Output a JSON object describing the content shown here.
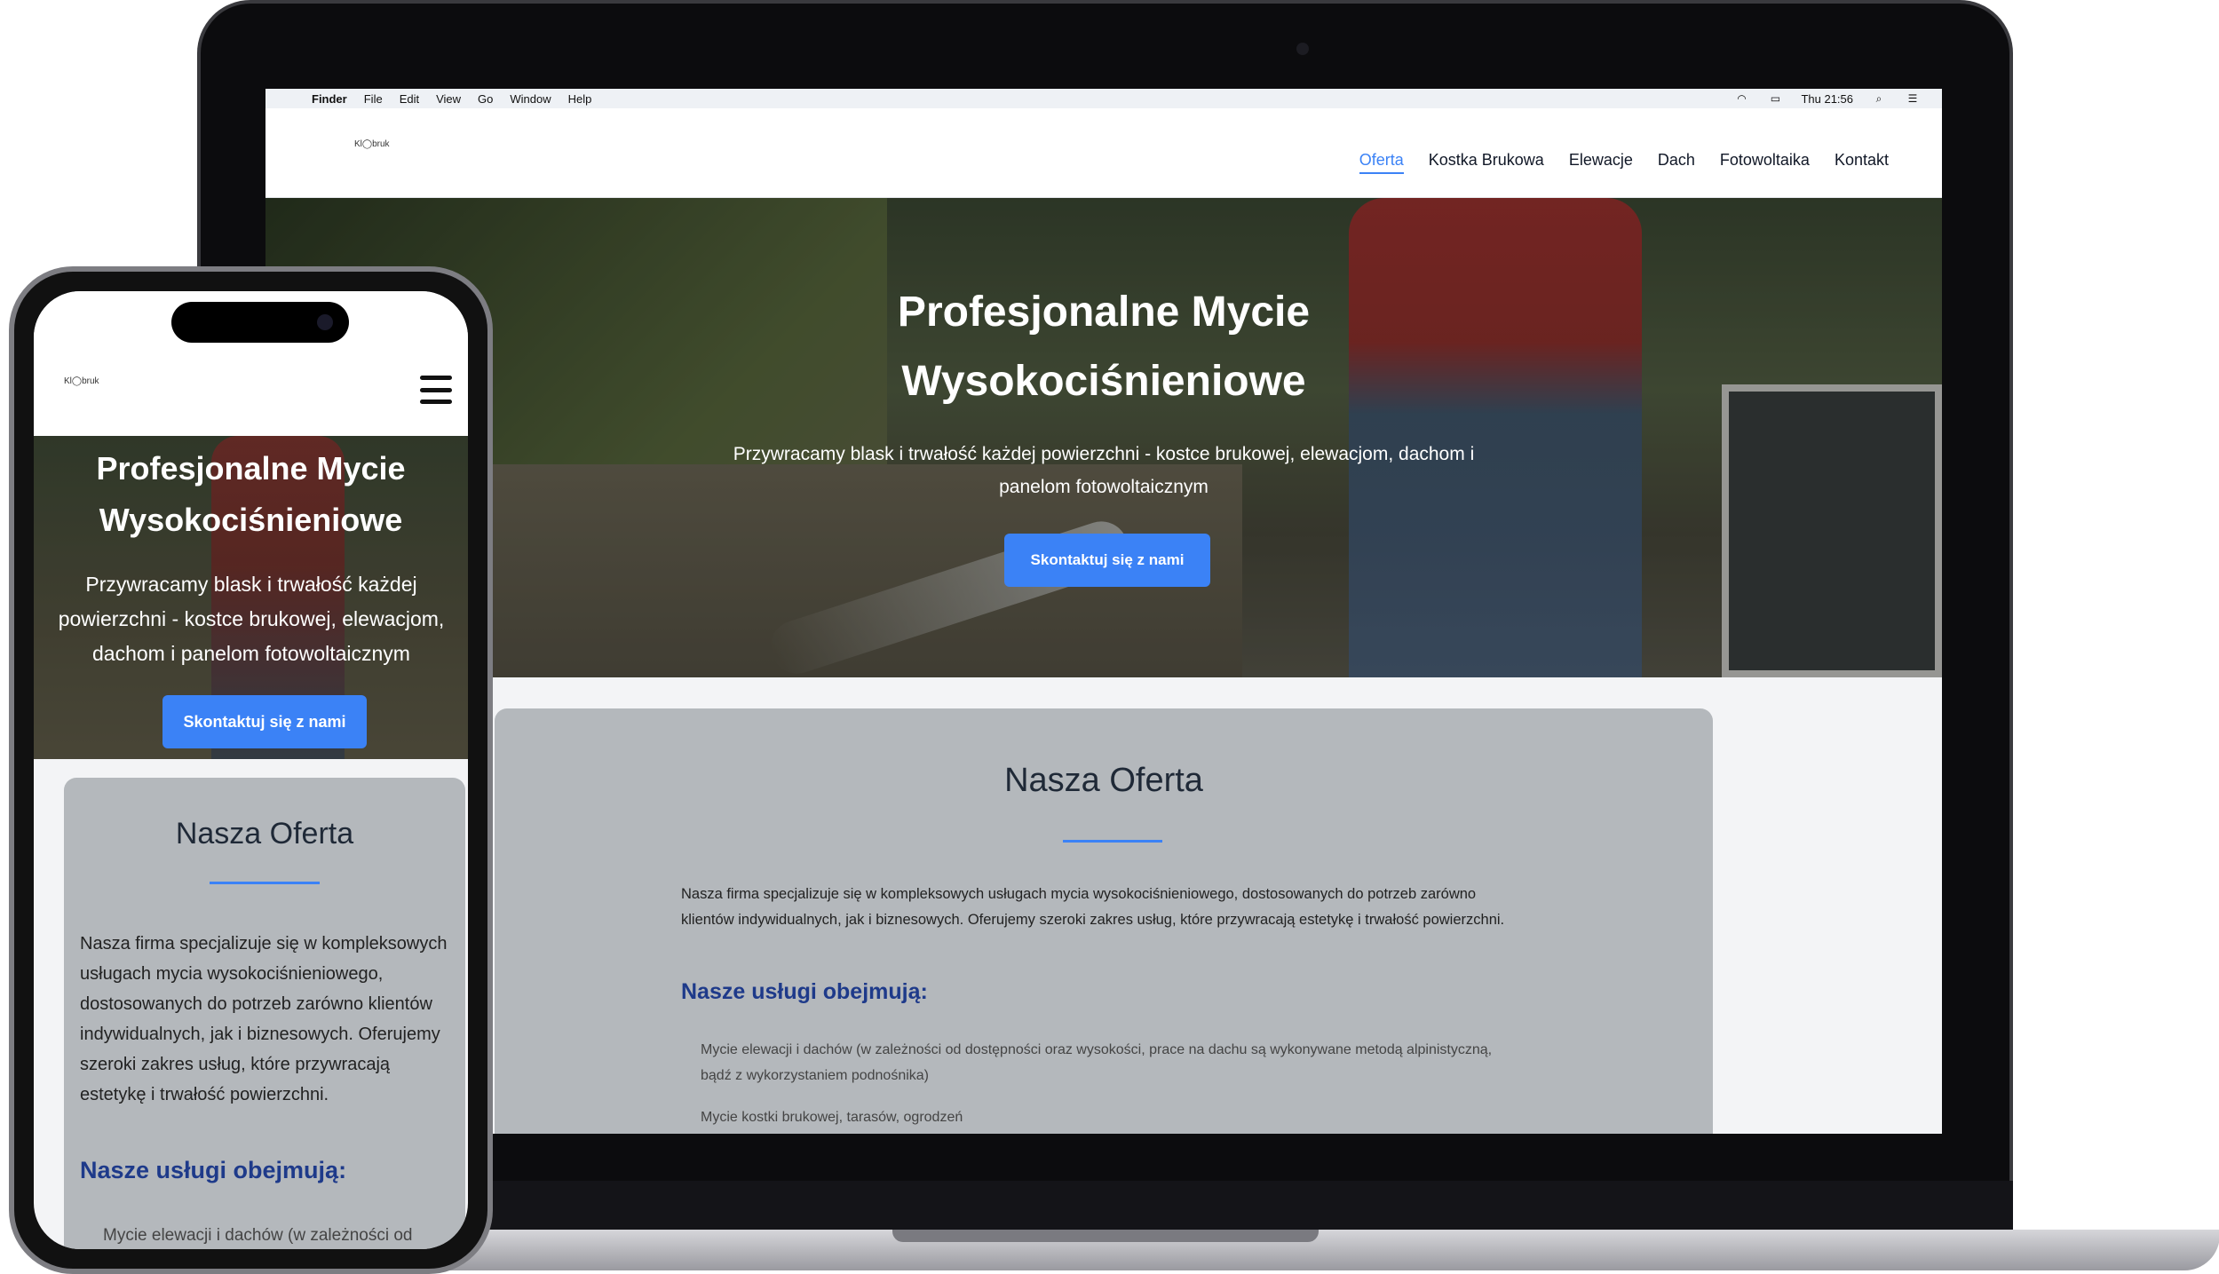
{
  "menubar": {
    "items": [
      "Finder",
      "File",
      "Edit",
      "View",
      "Go",
      "Window",
      "Help"
    ],
    "clock": "Thu 21:56"
  },
  "site": {
    "logo": "Kl◯bruk",
    "nav": [
      "Oferta",
      "Kostka Brukowa",
      "Elewacje",
      "Dach",
      "Fotowoltaika",
      "Kontakt"
    ],
    "hero": {
      "title_line1": "Profesjonalne Mycie",
      "title_line2": "Wysokociśnieniowe",
      "subtitle": "Przywracamy blask i trwałość każdej powierzchni - kostce brukowej, elewacjom, dachom i panelom fotowoltaicznym",
      "cta": "Skontaktuj się z nami"
    },
    "offer": {
      "title": "Nasza Oferta",
      "text": "Nasza firma specjalizuje się w kompleksowych usługach mycia wysokociśnieniowego, dostosowanych do potrzeb zarówno klientów indywidualnych, jak i biznesowych. Oferujemy szeroki zakres usług, które przywracają estetykę i trwałość powierzchni.",
      "services_title": "Nasze usługi obejmują:",
      "services": [
        "Mycie elewacji i dachów (w zależności od dostępności oraz wysokości, prace na dachu są wykonywane metodą alpinistyczną, bądź z wykorzystaniem podnośnika)",
        "Mycie kostki brukowej, tarasów, ogrodzeń"
      ],
      "phone_service_preview": "Mycie elewacji i dachów (w zależności od"
    }
  },
  "colors": {
    "accent": "#3b82f6",
    "heading_blue": "#1e3a8a",
    "card_gray": "#b4b8bc"
  },
  "icons": [
    "wifi-icon",
    "battery-icon",
    "search-icon",
    "list-icon",
    "hamburger-menu-icon"
  ]
}
